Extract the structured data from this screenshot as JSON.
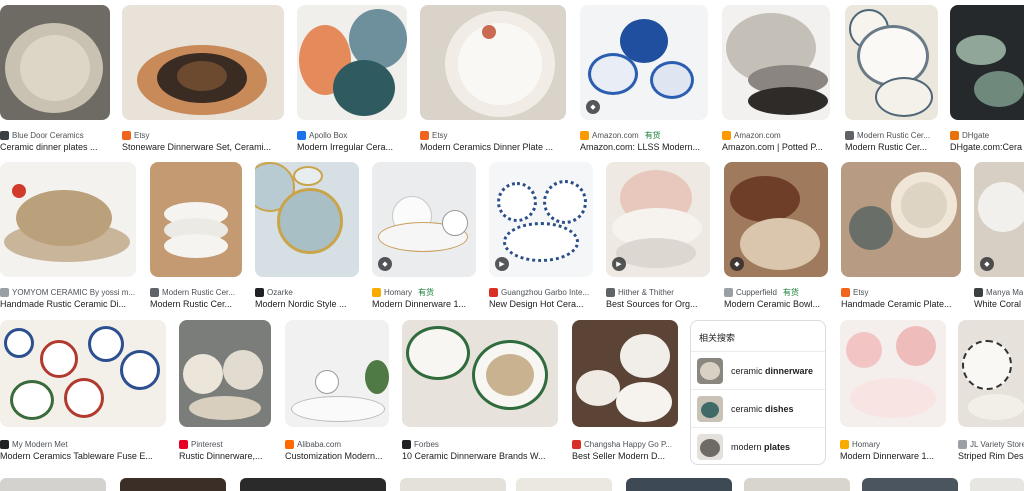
{
  "results": [
    {
      "source": "Blue Door Ceramics",
      "title": "Ceramic dinner plates ...",
      "favicon": "#3c4043",
      "badge": ""
    },
    {
      "source": "Etsy",
      "title": "Stoneware Dinnerware Set, Cerami...",
      "favicon": "#f1641e",
      "badge": ""
    },
    {
      "source": "Apollo Box",
      "title": "Modern Irregular Cera...",
      "favicon": "#1a73e8",
      "badge": ""
    },
    {
      "source": "Etsy",
      "title": "Modern Ceramics Dinner Plate ...",
      "favicon": "#f1641e",
      "badge": ""
    },
    {
      "source": "Amazon.com",
      "title": "Amazon.com: LLSS Modern...",
      "favicon": "#ff9900",
      "badge": "有货"
    },
    {
      "source": "Amazon.com",
      "title": "Amazon.com | Potted P...",
      "favicon": "#ff9900",
      "badge": ""
    },
    {
      "source": "Modern Rustic Cer...",
      "title": "Modern Rustic Cer...",
      "favicon": "#5f6368",
      "badge": ""
    },
    {
      "source": "DHgate",
      "title": "DHgate.com:Cera",
      "favicon": "#e8710a",
      "badge": ""
    },
    {
      "source": "YOMYOM CERAMIC By yossi m...",
      "title": "Handmade Rustic Ceramic Di...",
      "favicon": "#9aa0a6",
      "badge": ""
    },
    {
      "source": "Modern Rustic Cer...",
      "title": "Modern Rustic Cer...",
      "favicon": "#5f6368",
      "badge": ""
    },
    {
      "source": "Ozarke",
      "title": "Modern Nordic Style ...",
      "favicon": "#202124",
      "badge": ""
    },
    {
      "source": "Homary",
      "title": "Modern Dinnerware 1...",
      "favicon": "#f9ab00",
      "badge": "有货"
    },
    {
      "source": "Guangzhou Garbo Inte...",
      "title": "New Design Hot Cera...",
      "favicon": "#d93025",
      "badge": ""
    },
    {
      "source": "Hither & Thither",
      "title": "Best Sources for Org...",
      "favicon": "#5f6368",
      "badge": ""
    },
    {
      "source": "Cupperfield",
      "title": "Modern Ceramic Bowl...",
      "favicon": "#9aa0a6",
      "badge": "有货"
    },
    {
      "source": "Etsy",
      "title": "Handmade Ceramic Plate...",
      "favicon": "#f1641e",
      "badge": ""
    },
    {
      "source": "Manya Ma",
      "title": "White Coral",
      "favicon": "#3c4043",
      "badge": ""
    },
    {
      "source": "My Modern Met",
      "title": "Modern Ceramics Tableware Fuse E...",
      "favicon": "#202124",
      "badge": ""
    },
    {
      "source": "Pinterest",
      "title": "Rustic Dinnerware,...",
      "favicon": "#e60023",
      "badge": ""
    },
    {
      "source": "Alibaba.com",
      "title": "Customization Modern...",
      "favicon": "#ff6a00",
      "badge": ""
    },
    {
      "source": "Forbes",
      "title": "10 Ceramic Dinnerware Brands W...",
      "favicon": "#202124",
      "badge": ""
    },
    {
      "source": "Changsha Happy Go P...",
      "title": "Best Seller Modern D...",
      "favicon": "#d93025",
      "badge": ""
    },
    {
      "source": "Homary",
      "title": "Modern Dinnerware 1...",
      "favicon": "#f9ab00",
      "badge": ""
    },
    {
      "source": "JL Variety Store",
      "title": "Striped Rim Des",
      "favicon": "#9aa0a6",
      "badge": ""
    }
  ],
  "related": {
    "heading": "相关搜索",
    "items": [
      {
        "prefix": "ceramic ",
        "bold": "dinnerware"
      },
      {
        "prefix": "ceramic ",
        "bold": "dishes"
      },
      {
        "prefix": "modern ",
        "bold": "plates"
      }
    ]
  }
}
